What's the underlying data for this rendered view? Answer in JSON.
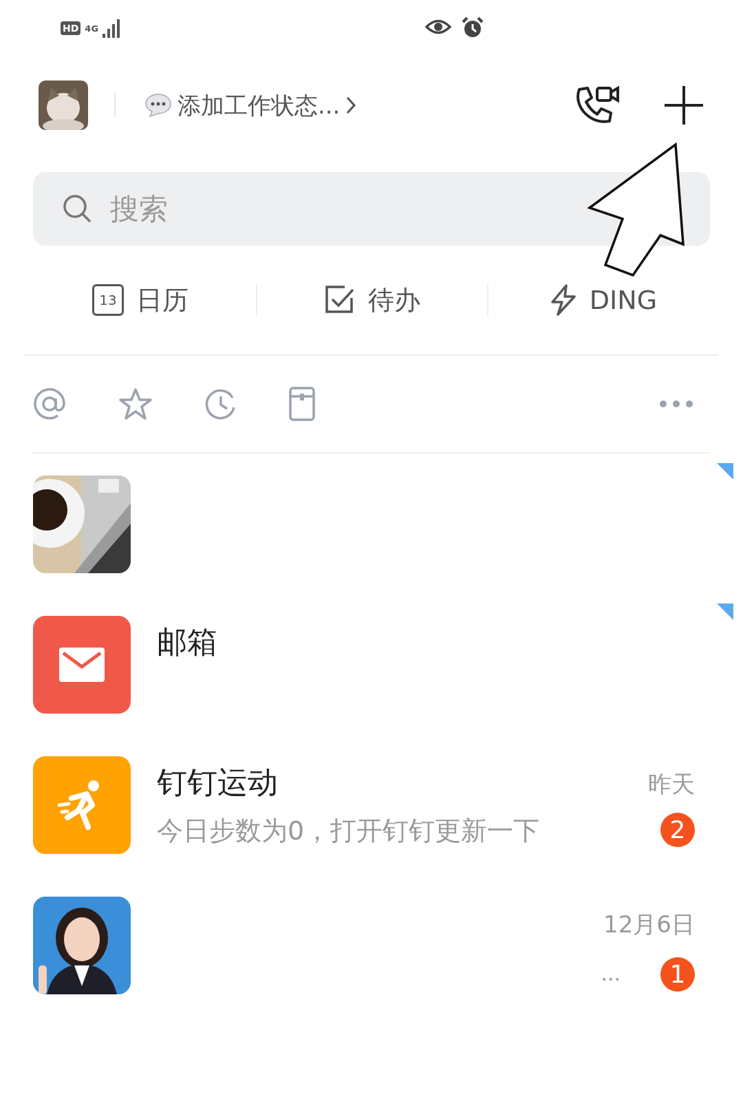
{
  "status_bar": {
    "hd": "HD",
    "network": "4G"
  },
  "header": {
    "status_prompt": "添加工作状态..."
  },
  "search": {
    "placeholder": "搜索"
  },
  "shortcuts": [
    {
      "kind": "calendar",
      "label": "日历",
      "day": "13"
    },
    {
      "kind": "todo",
      "label": "待办"
    },
    {
      "kind": "ding",
      "label": "DING"
    }
  ],
  "chats": [
    {
      "kind": "picture",
      "pinned": true
    },
    {
      "kind": "mail",
      "name": "邮箱",
      "pinned": true
    },
    {
      "kind": "sport",
      "name": "钉钉运动",
      "preview": "今日步数为0，打开钉钉更新一下",
      "time": "昨天",
      "badge": "2",
      "pinned": false
    },
    {
      "kind": "person",
      "time": "12月6日",
      "preview": "···",
      "badge": "1",
      "pinned": false
    }
  ],
  "annotation": {
    "kind": "arrow"
  }
}
